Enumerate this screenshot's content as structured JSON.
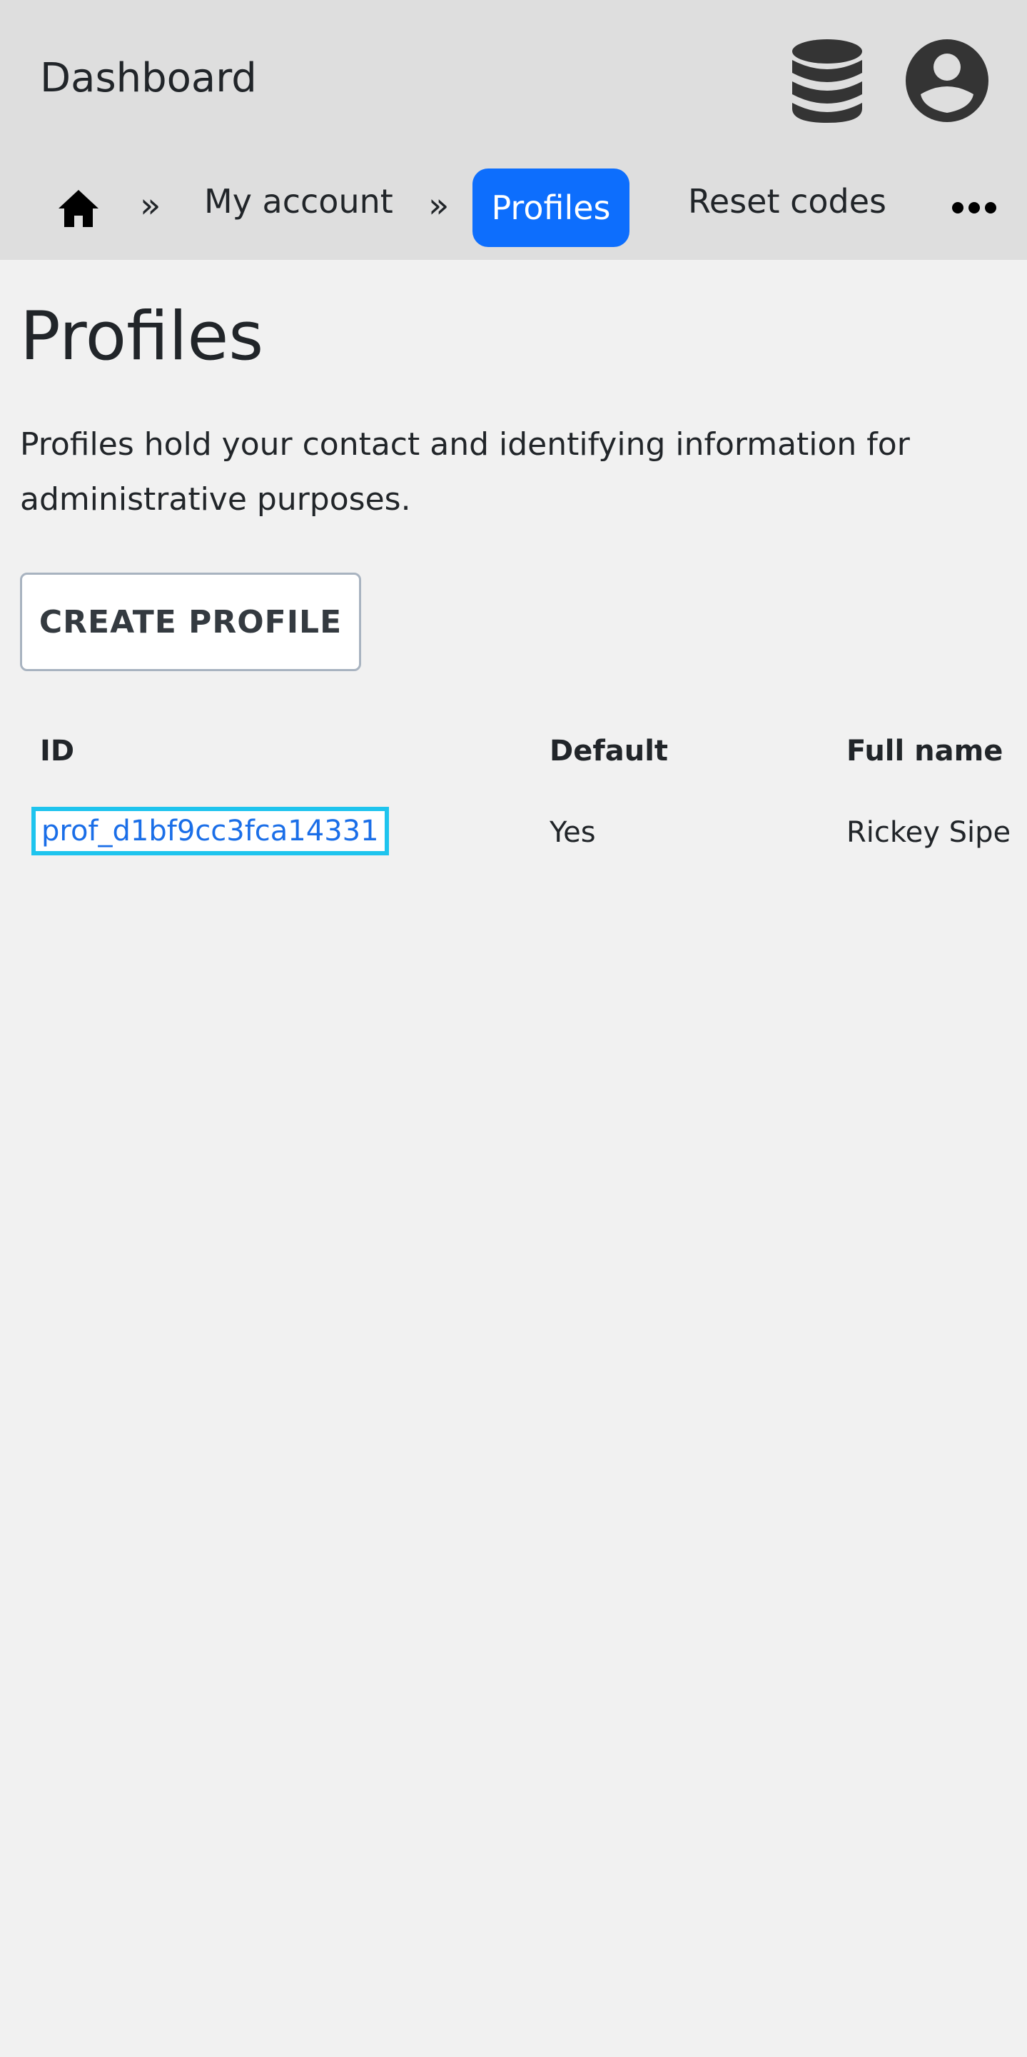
{
  "header": {
    "brand": "Dashboard",
    "icons": [
      "database-icon",
      "user-circle-icon"
    ]
  },
  "breadcrumb": {
    "home_icon": "home-icon",
    "separator": "»",
    "items": [
      {
        "label": "My account"
      },
      {
        "label": "Profiles",
        "active": true
      },
      {
        "label": "Reset codes"
      }
    ],
    "more_icon": "ellipsis-icon"
  },
  "page": {
    "title": "Profiles",
    "description": "Profiles hold your contact and identifying information for administrative purposes.",
    "create_button": "CREATE PROFILE"
  },
  "table": {
    "columns": [
      "ID",
      "Default",
      "Full name"
    ],
    "rows": [
      {
        "id": "prof_d1bf9cc3fca14331",
        "default": "Yes",
        "full_name": "Rickey Sipe"
      }
    ]
  },
  "colors": {
    "accent": "#0d6efd",
    "focus_outline": "#1ec4ee",
    "link": "#1a6ee8",
    "header_bg": "#dedede",
    "page_bg": "#f1f1f1"
  }
}
